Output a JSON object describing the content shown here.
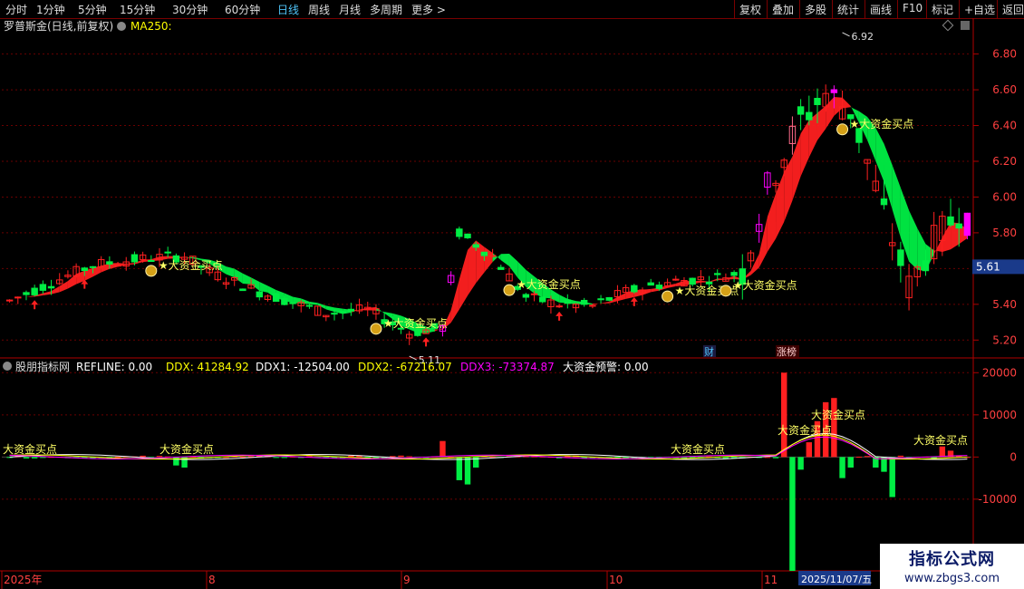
{
  "toolbar": {
    "left": [
      "分时",
      "1分钟",
      "5分钟",
      "15分钟",
      "30分钟",
      "60分钟",
      "日线",
      "周线",
      "月线",
      "多周期",
      "更多 >"
    ],
    "right": [
      "复权",
      "叠加",
      "多股",
      "统计",
      "画线",
      "F10",
      "标记",
      "+自选",
      "返回"
    ],
    "active": "日线"
  },
  "main_header": {
    "title": "罗普斯金(日线,前复权)",
    "ma_label": "MA250:"
  },
  "sub_header": {
    "title": "股朋指标网",
    "items": [
      {
        "text": "REFLINE: 0.00",
        "color": "#ffffff"
      },
      {
        "text": "DDX: 41284.92",
        "color": "#ffff00"
      },
      {
        "text": "DDX1: -12504.00",
        "color": "#ffffff"
      },
      {
        "text": "DDX2: -67216.07",
        "color": "#ffff00"
      },
      {
        "text": "DDX3: -73374.87",
        "color": "#ff00ff"
      },
      {
        "text": "大资金预警: 0.00",
        "color": "#ffffff"
      }
    ]
  },
  "colors": {
    "up": "#ff2020",
    "down": "#00ee44",
    "magenta": "#ff00ff",
    "pink": "#ff6b8a",
    "label": "#ffff66",
    "axis": "#b00000"
  },
  "annotations": {
    "buy_label": "大资金买点",
    "high_label": "6.92",
    "low_label": "5.11",
    "price_tag": "5.61",
    "badge_cai": "财",
    "badge_zhangbang": "涨榜",
    "date_box": "2025/11/07/五",
    "sub_stacked_label": "大资金买点"
  },
  "watermark": {
    "title": "指标公式网",
    "url": "www.zbgs3.com"
  },
  "chart_data": [
    {
      "type": "candlestick",
      "title": "罗普斯金(日线,前复权)",
      "y_ticks": [
        5.2,
        5.4,
        5.6,
        5.8,
        6.0,
        6.2,
        6.4,
        6.6,
        6.8
      ],
      "ylim": [
        5.1,
        6.94
      ],
      "x_labels": [
        "2025年",
        "8",
        "9",
        "10",
        "11"
      ],
      "high": 6.92,
      "low": 5.11,
      "last": 5.61,
      "grid": true
    },
    {
      "type": "bar",
      "title": "股朋指标网",
      "series": [
        "REFLINE",
        "DDX",
        "DDX1",
        "DDX2",
        "DDX3",
        "大资金预警"
      ],
      "y_ticks": [
        -10000,
        0,
        10000,
        20000
      ],
      "ylim": [
        -27000,
        23500
      ],
      "grid": true
    }
  ]
}
